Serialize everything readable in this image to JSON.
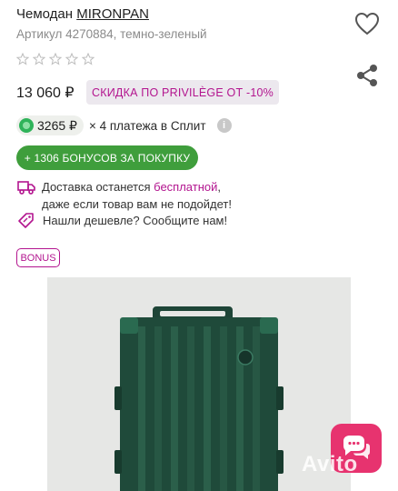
{
  "product": {
    "title_prefix": "Чемодан ",
    "brand": "MIRONPAN",
    "sku_line": "Артикул 4270884, темно-зеленый"
  },
  "rating": {
    "stars_filled": 0,
    "stars_total": 5
  },
  "price": {
    "value": "13 060 ₽"
  },
  "discount": {
    "label": "СКИДКА ПО PRIVILÈGE ОТ -10%"
  },
  "split": {
    "amount": "3265 ₽",
    "text": "× 4 платежа в Сплит",
    "info_symbol": "i"
  },
  "bonus_button": {
    "label": "+ 1306 БОНУСОВ ЗА ПОКУПКУ"
  },
  "delivery": {
    "line1_start": "Доставка останется ",
    "line1_highlight": "бесплатной",
    "line1_end": ",",
    "line2": "даже если товар вам не подойдет!"
  },
  "cheaper": {
    "text": "Нашли дешевле? Сообщите нам!"
  },
  "bonus_tag": {
    "label": "BONUS"
  },
  "watermark": {
    "text": "Avito"
  },
  "colors": {
    "accent": "#b3158f",
    "green": "#3f9e3c",
    "chat": "#e7336f",
    "suitcase": "#1f4a3a"
  },
  "icons": [
    "heart-icon",
    "share-icon",
    "star-icon",
    "truck-icon",
    "price-tag-icon",
    "info-icon",
    "chat-icon"
  ]
}
